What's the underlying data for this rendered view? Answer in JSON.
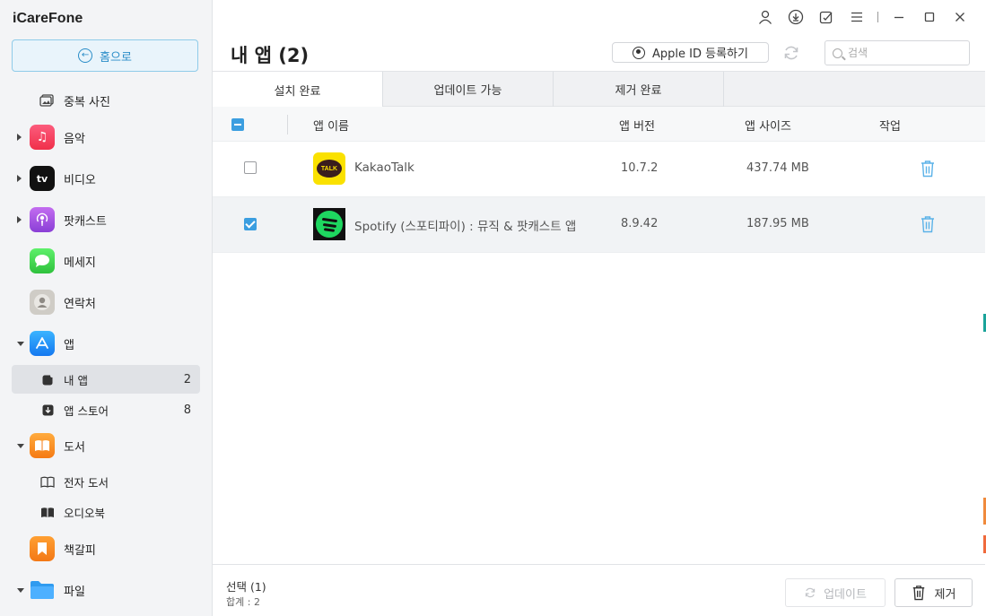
{
  "app": {
    "title": "iCareFone"
  },
  "sidebar": {
    "home_label": "홈으로",
    "items": [
      {
        "label": "중복 사진"
      },
      {
        "label": "음악"
      },
      {
        "label": "비디오",
        "icon_text": "tv"
      },
      {
        "label": "팟캐스트"
      },
      {
        "label": "메세지"
      },
      {
        "label": "연락처"
      },
      {
        "label": "앱"
      },
      {
        "label": "내 앱",
        "count": "2"
      },
      {
        "label": "앱 스토어",
        "count": "8"
      },
      {
        "label": "도서"
      },
      {
        "label": "전자 도서"
      },
      {
        "label": "오디오북"
      },
      {
        "label": "책갈피"
      },
      {
        "label": "파일"
      }
    ]
  },
  "header": {
    "page_title": "내 앱 (2)",
    "apple_id_button": "Apple ID 등록하기",
    "search_placeholder": "검색"
  },
  "tabs": [
    {
      "label": "설치 완료",
      "active": true
    },
    {
      "label": "업데이트 가능",
      "active": false
    },
    {
      "label": "제거 완료",
      "active": false
    }
  ],
  "table": {
    "columns": [
      "앱 이름",
      "앱 버전",
      "앱 사이즈",
      "작업"
    ],
    "rows": [
      {
        "name": "KakaoTalk",
        "logo_text": "TALK",
        "version": "10.7.2",
        "size": "437.74 MB",
        "checked": false
      },
      {
        "name": "Spotify (스포티파이) : 뮤직 & 팟캐스트 앱",
        "version": "8.9.42",
        "size": "187.95 MB",
        "checked": true
      }
    ]
  },
  "footer": {
    "selected": "선택 (1)",
    "total": "합계 : 2",
    "update_button": "업데이트",
    "remove_button": "제거"
  },
  "colors": {
    "accent": "#3b9ee0",
    "home_button_text": "#2a8dc8",
    "kakao_yellow": "#fae100",
    "spotify_green": "#1ed760"
  }
}
